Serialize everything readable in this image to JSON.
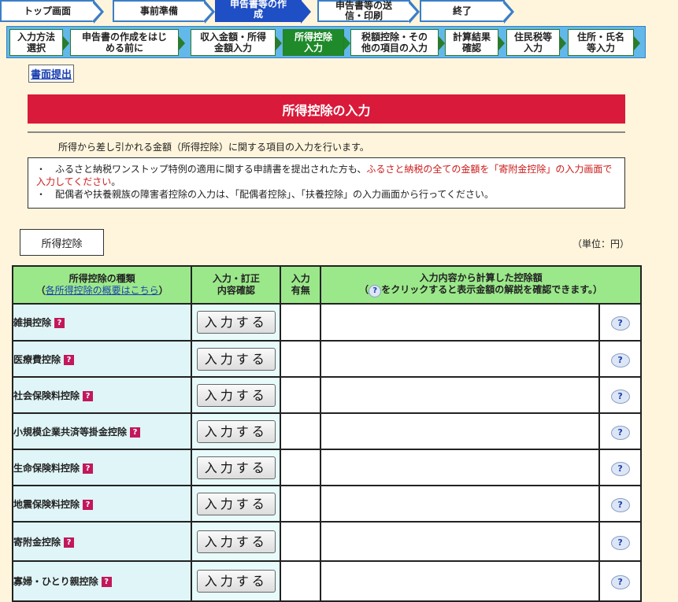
{
  "top_steps": [
    {
      "label": "トップ画面",
      "active": false
    },
    {
      "label": "事前準備",
      "active": false
    },
    {
      "label": "申告書等の作成",
      "active": true
    },
    {
      "label": "申告書等の送信・印刷",
      "active": false
    },
    {
      "label": "終了",
      "active": false
    }
  ],
  "sub_steps": [
    {
      "line1": "入力方法",
      "line2": "選択",
      "active": false
    },
    {
      "line1": "申告書の作成をはじ",
      "line2": "める前に",
      "active": false
    },
    {
      "line1": "収入金額・所得",
      "line2": "金額入力",
      "active": false
    },
    {
      "line1": "所得控除",
      "line2": "入力",
      "active": true
    },
    {
      "line1": "税額控除・その",
      "line2": "他の項目の入力",
      "active": false
    },
    {
      "line1": "計算結果",
      "line2": "確認",
      "active": false
    },
    {
      "line1": "住民税等",
      "line2": "入力",
      "active": false
    },
    {
      "line1": "住所・氏名",
      "line2": "等入力",
      "active": false
    }
  ],
  "shomen_link": "書面提出",
  "page_title": "所得控除の入力",
  "intro_text": "所得から差し引かれる金額（所得控除）に関する項目の入力を行います。",
  "notice": {
    "line1_a": "・　ふるさと納税ワンストップ特例の適用に関する申請書を提出された方も、",
    "line1_red": "ふるさと納税の全ての金額を「寄附金控除」の入力画面で入力してください",
    "line1_b": "。",
    "line2": "・　配偶者や扶養親族の障害者控除の入力は、「配偶者控除」、「扶養控除」の入力画面から行ってください。"
  },
  "section_tab": "所得控除",
  "unit_label": "（単位：円）",
  "table_header": {
    "kind": "所得控除の種類",
    "kind_link": "各所得控除の概要はこちら",
    "confirm_line1": "入力・訂正",
    "confirm_line2": "内容確認",
    "has_input_line1": "入力",
    "has_input_line2": "有無",
    "calc_line1": "入力内容から計算した控除額",
    "calc_line2_a": "（",
    "calc_line2_b": "をクリックすると表示金額の解説を確認できます。）"
  },
  "input_button_label": "入力する",
  "rows": [
    {
      "name": "雑損控除"
    },
    {
      "name": "医療費控除"
    },
    {
      "name": "社会保険料控除"
    },
    {
      "name": "小規模企業共済等掛金控除"
    },
    {
      "name": "生命保険料控除"
    },
    {
      "name": "地震保険料控除"
    },
    {
      "name": "寄附金控除"
    },
    {
      "name": "寡婦・ひとり親控除"
    }
  ],
  "colors": {
    "accent_red": "#d91a3a",
    "header_green": "#9be88a",
    "nav_blue": "#1f4fc4",
    "sub_active_green": "#1f8a2a"
  }
}
